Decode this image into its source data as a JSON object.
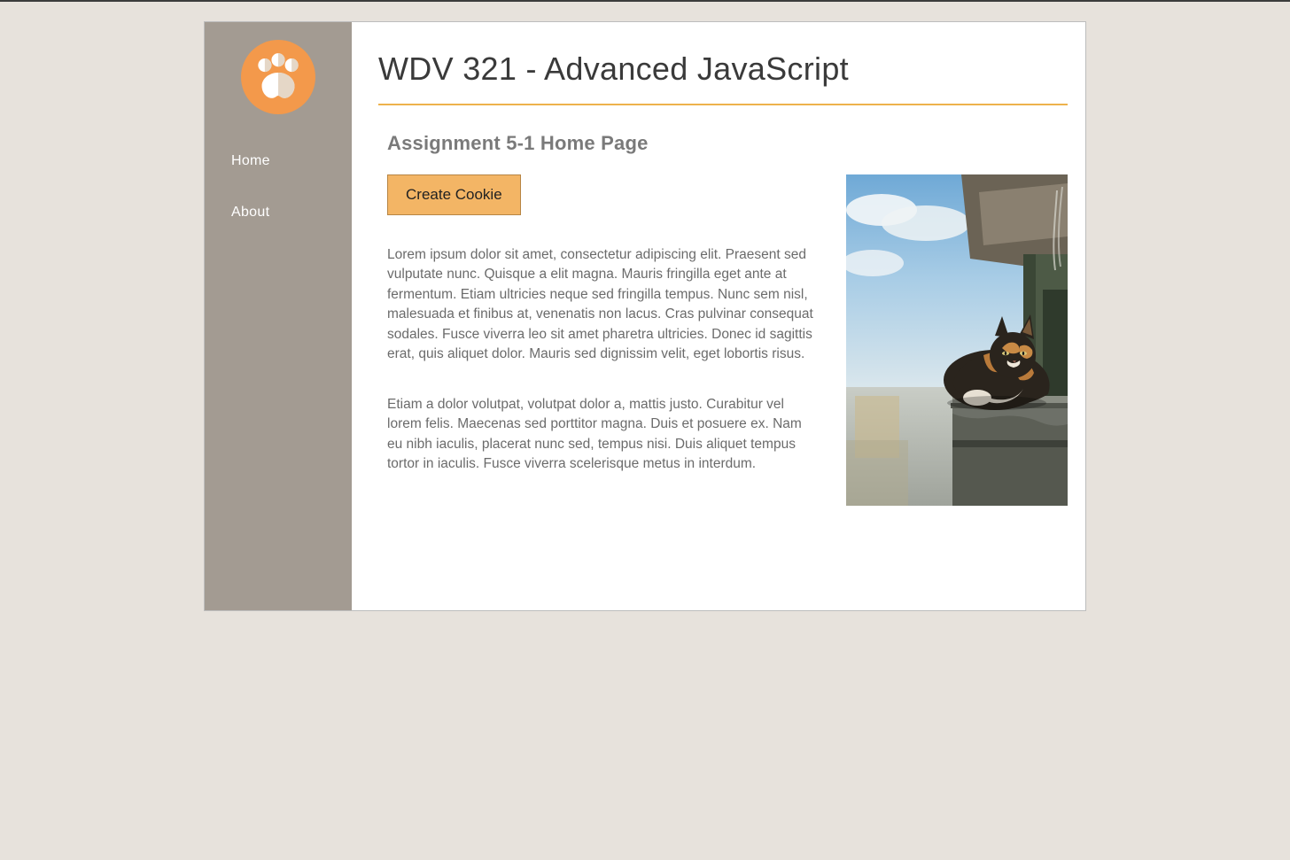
{
  "nav": {
    "items": [
      {
        "label": "Home"
      },
      {
        "label": "About"
      }
    ]
  },
  "header": {
    "course_title": "WDV 321 - Advanced JavaScript"
  },
  "main": {
    "assignment_title": "Assignment 5-1 Home Page",
    "button_label": "Create Cookie",
    "para1": "Lorem ipsum dolor sit amet, consectetur adipiscing elit. Praesent sed vulputate nunc. Quisque a elit magna. Mauris fringilla eget ante at fermentum. Etiam ultricies neque sed fringilla tempus. Nunc sem nisl, malesuada et finibus at, venenatis non lacus. Cras pulvinar consequat sodales. Fusce viverra leo sit amet pharetra ultricies. Donec id sagittis erat, quis aliquet dolor. Mauris sed dignissim velit, eget lobortis risus.",
    "para2": "Etiam a dolor volutpat, volutpat dolor a, mattis justo. Curabitur vel lorem felis. Maecenas sed porttitor magna. Duis et posuere ex. Nam eu nibh iaculis, placerat nunc sed, tempus nisi. Duis aliquet tempus tortor in iaculis. Fusce viverra scelerisque metus in interdum."
  },
  "colors": {
    "accent_orange": "#f3b565",
    "accent_rule": "#edb24c",
    "sidebar_bg": "#a39b92",
    "page_bg": "#e7e2dc"
  }
}
